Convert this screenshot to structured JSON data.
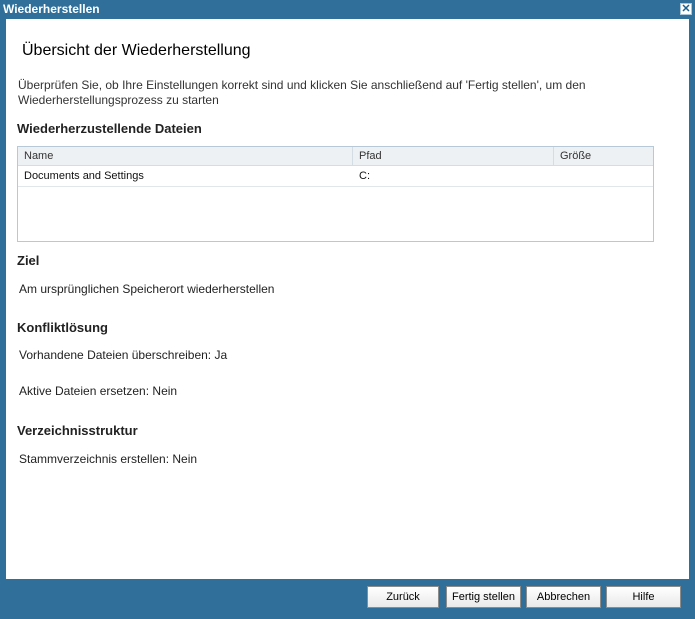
{
  "window": {
    "title": "Wiederherstellen"
  },
  "summary": {
    "heading": "Übersicht der Wiederherstellung",
    "intro": "Überprüfen Sie, ob Ihre Einstellungen korrekt sind und klicken Sie anschließend auf 'Fertig stellen', um den Wiederherstellungsprozess zu starten"
  },
  "files_section": {
    "heading": "Wiederherzustellende Dateien",
    "columns": [
      "Name",
      "Pfad",
      "Größe"
    ],
    "rows": [
      {
        "name": "Documents and Settings",
        "path": "C:",
        "size": ""
      }
    ]
  },
  "destination": {
    "heading": "Ziel",
    "value": "Am ursprünglichen Speicherort wiederherstellen"
  },
  "conflict": {
    "heading": "Konfliktlösung",
    "overwrite": "Vorhandene Dateien überschreiben: Ja",
    "replace_active": "Aktive Dateien ersetzen: Nein"
  },
  "directory": {
    "heading": "Verzeichnisstruktur",
    "root": "Stammverzeichnis erstellen: Nein"
  },
  "buttons": {
    "back": "Zurück",
    "finish": "Fertig stellen",
    "cancel": "Abbrechen",
    "help": "Hilfe"
  },
  "colors": {
    "chrome": "#2f6f9a",
    "content_bg": "#ffffff"
  },
  "icons": {
    "close": "close-icon"
  }
}
